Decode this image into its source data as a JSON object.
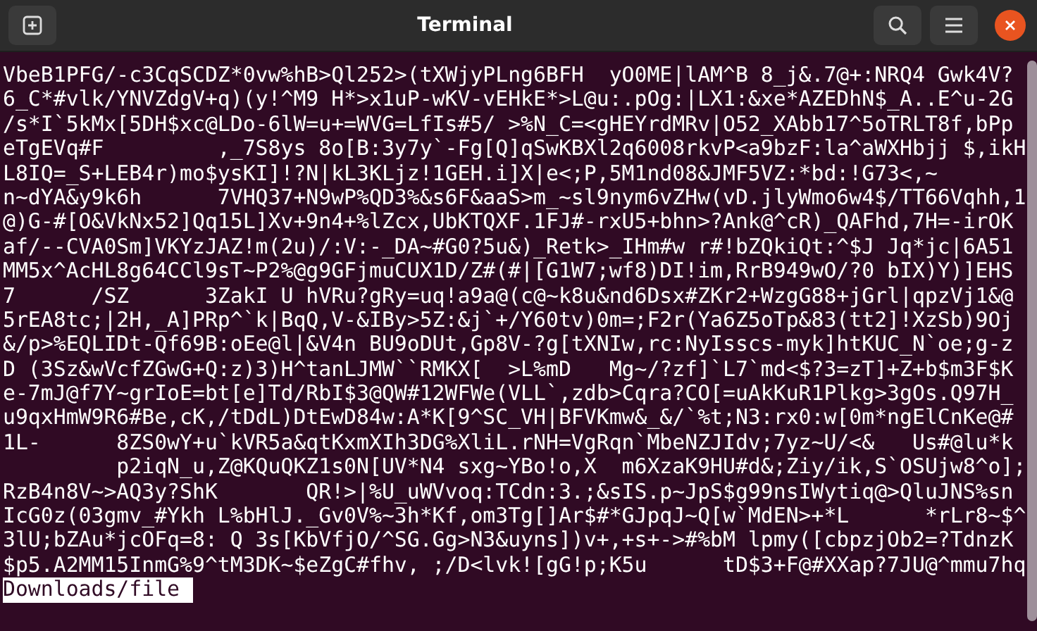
{
  "window": {
    "title": "Terminal"
  },
  "terminal": {
    "lines": [
      "VbeB1PFG/-c3CqSCDZ*0vw%hB>Ql252>(tXWjyPLng6BFH  yO0ME|lAM^B 8_j&.7@+:NRQ4 Gwk4V?",
      "6_C*#vlk/YNVZdgV+q)(y!^M9 H*>x1uP-wKV-vEHkE*>L@u:.pOg:|LX1:&xe*AZEDhN$_A..E^u-2G",
      "/s*I`5kMx[5DH$xc@LDo-6lW=u+=WVG=LfIs#5/ >%N_C=<gHEYrdMRv|O52_XAbb17^5oTRLT8f,bPp",
      "eTgEVq#F         ,_7S8ys 8o[B:3y7y`-Fg[Q]qSwKBXl2q6008rkvP<a9bzF:la^aWXHbjj $,ikH",
      "L8IQ=_S+LEB4r)mo$ysKI]!?N|kL3KLjz!1GEH.i]X|e<;P,5M1nd08&JMF5VZ:*bd:!G73<,~",
      "n~dYA&y9k6h      7VHQ37+N9wP%QD3%&s6F&aaS>m_~sl9nym6vZHw(vD.jlyWmo6w4$/TT66Vqhh,1",
      "@)G-#[O&VkNx52]Qq15L]Xv+9n4+%lZcx,UbKTQXF.1FJ#-rxU5+bhn>?Ank@^cR)_QAFhd,7H=-irOK",
      "af/--CVA0Sm]VKYzJAZ!m(2u)/:V:-_DA~#G0?5u&)_Retk>_IHm#w r#!bZQkiQt:^$J Jq*jc|6A51",
      "MM5x^AcHL8g64CCl9sT~P2%@g9GFjmuCUX1D/Z#(#|[G1W7;wf8)DI!im,RrB949wO/?0 bIX)Y)]EHS",
      "7      /SZ      3ZakI U hVRu?gRy=uq!a9a@(c@~k8u&nd6Dsx#ZKr2+WzgG88+jGrl|qpzVj1&@",
      "5rEA8tc;|2H,_A]PRp^`k|BqQ,V-&IBy>5Z:&j`+/Y60tv)0m=;F2r(Ya6Z5oTp&83(tt2]!XzSb)9Oj",
      "&/p>%EQLIDt-Qf69B:oEe@l|&V4n BU9oDUt,Gp8V-?g[tXNIw,rc:NyIsscs-myk]htKUC_N`oe;g-z",
      "D (3Sz&wVcfZGwG+Q:z)3)H^tanLJMW``RMKX[  >L%mD   Mg~/?zf]`L7`md<$?3=zT]+Z+b$m3F$K",
      "e-7mJ@f7Y~grIoE=bt[e]Td/RbI$3@QW#12WFWe(VLL`,zdb>Cqra?CO[=uAkKuR1Plkg>3gOs.Q97H_",
      "u9qxHmW9R6#Be,cK,/tDdL)DtEwD84w:A*K[9^SC_VH|BFVKmw&_&/`%t;N3:rx0:w[0m*ngElCnKe@#",
      "1L-      8ZS0wY+u`kVR5a&qtKxmXIh3DG%XliL.rNH=VgRqn`MbeNZJIdv;7yz~U/<&   Us#@lu*k",
      "         p2iqN_u,Z@KQuQKZ1s0N[UV*N4 sxg~YBo!o,X  m6XzaK9HU#d&;Ziy/ik,S`OSUjw8^o];",
      "RzB4n8V~>AQ3y?ShK       QR!>|%U_uWVvoq:TCdn:3.;&sIS.p~JpS$g99nsIWytiq@>QluJNS%sn",
      "IcG0z(03gmv_#Ykh L%bHlJ._Gv0V%~3h*Kf,om3Tg[]Ar$#*GJpqJ~Q[w`MdEN>+*L      *rLr8~$^",
      "3lU;bZAu*jcOFq=8: Q 3s[KbVfjO/^SG.Gg>N3&uyns])v+,+s+->#%bM lpmy([cbpzjOb2=?TdnzK",
      "$p5.A2MM15InmG%9^tM3DK~$eZgC#fhv, ;/D<lvk![gG!p;K5u      tD$3+F@#XXap?7JU@^mmu7hq"
    ],
    "prompt": "Downloads/file"
  }
}
